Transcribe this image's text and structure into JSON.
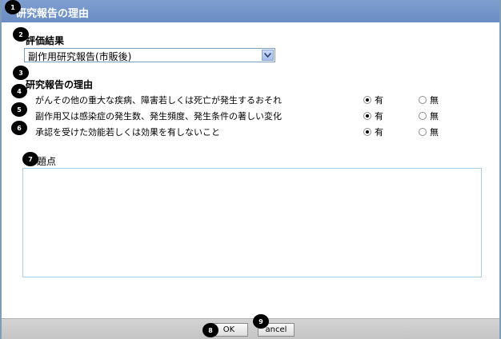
{
  "dialog": {
    "title": "研究報告の理由"
  },
  "markers": [
    "1",
    "2",
    "3",
    "4",
    "5",
    "6",
    "7",
    "8",
    "9"
  ],
  "evaluation": {
    "label": "評価結果",
    "selected": "副作用研究報告(市販後)"
  },
  "reasons": {
    "label": "研究報告の理由",
    "yes_label": "有",
    "no_label": "無",
    "items": [
      {
        "text": "がんその他の重大な疾病、障害若しくは死亡が発生するおそれ",
        "value": "有"
      },
      {
        "text": "副作用又は感染症の発生数、発生頻度、発生条件の著しい変化",
        "value": "有"
      },
      {
        "text": "承認を受けた効能若しくは効果を有しないこと",
        "value": "有"
      }
    ]
  },
  "issues": {
    "label": "題点",
    "value": ""
  },
  "footer": {
    "ok_label": "OK",
    "cancel_label": "ancel"
  }
}
